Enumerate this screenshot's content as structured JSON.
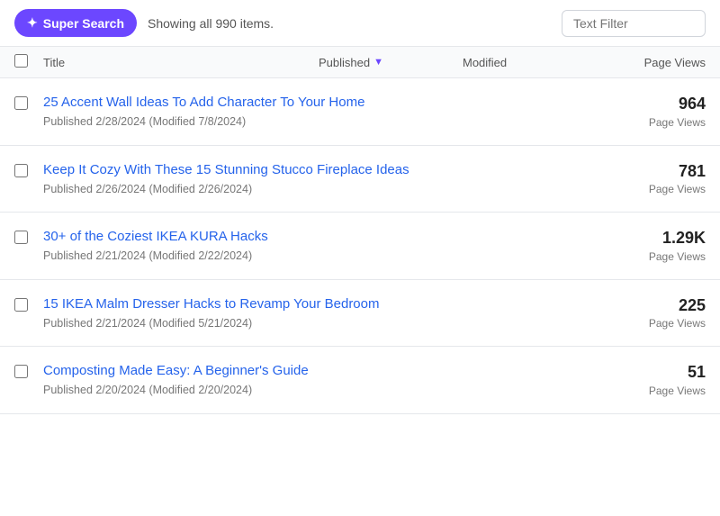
{
  "toolbar": {
    "super_search_label": "Super Search",
    "showing_label": "Showing all 990 items.",
    "text_filter_placeholder": "Text Filter"
  },
  "table_header": {
    "title_label": "Title",
    "published_label": "Published",
    "modified_label": "Modified",
    "pageviews_label": "Page Views"
  },
  "items": [
    {
      "title": "25 Accent Wall Ideas To Add Character To Your Home",
      "meta": "Published 2/28/2024 (Modified 7/8/2024)",
      "pageviews_count": "964",
      "pageviews_label": "Page Views"
    },
    {
      "title": "Keep It Cozy With These 15 Stunning Stucco Fireplace Ideas",
      "meta": "Published 2/26/2024 (Modified 2/26/2024)",
      "pageviews_count": "781",
      "pageviews_label": "Page Views"
    },
    {
      "title": "30+ of the Coziest IKEA KURA Hacks",
      "meta": "Published 2/21/2024 (Modified 2/22/2024)",
      "pageviews_count": "1.29K",
      "pageviews_label": "Page Views"
    },
    {
      "title": "15 IKEA Malm Dresser Hacks to Revamp Your Bedroom",
      "meta": "Published 2/21/2024 (Modified 5/21/2024)",
      "pageviews_count": "225",
      "pageviews_label": "Page Views"
    },
    {
      "title": "Composting Made Easy: A Beginner's Guide",
      "meta": "Published 2/20/2024 (Modified 2/20/2024)",
      "pageviews_count": "51",
      "pageviews_label": "Page Views"
    }
  ]
}
